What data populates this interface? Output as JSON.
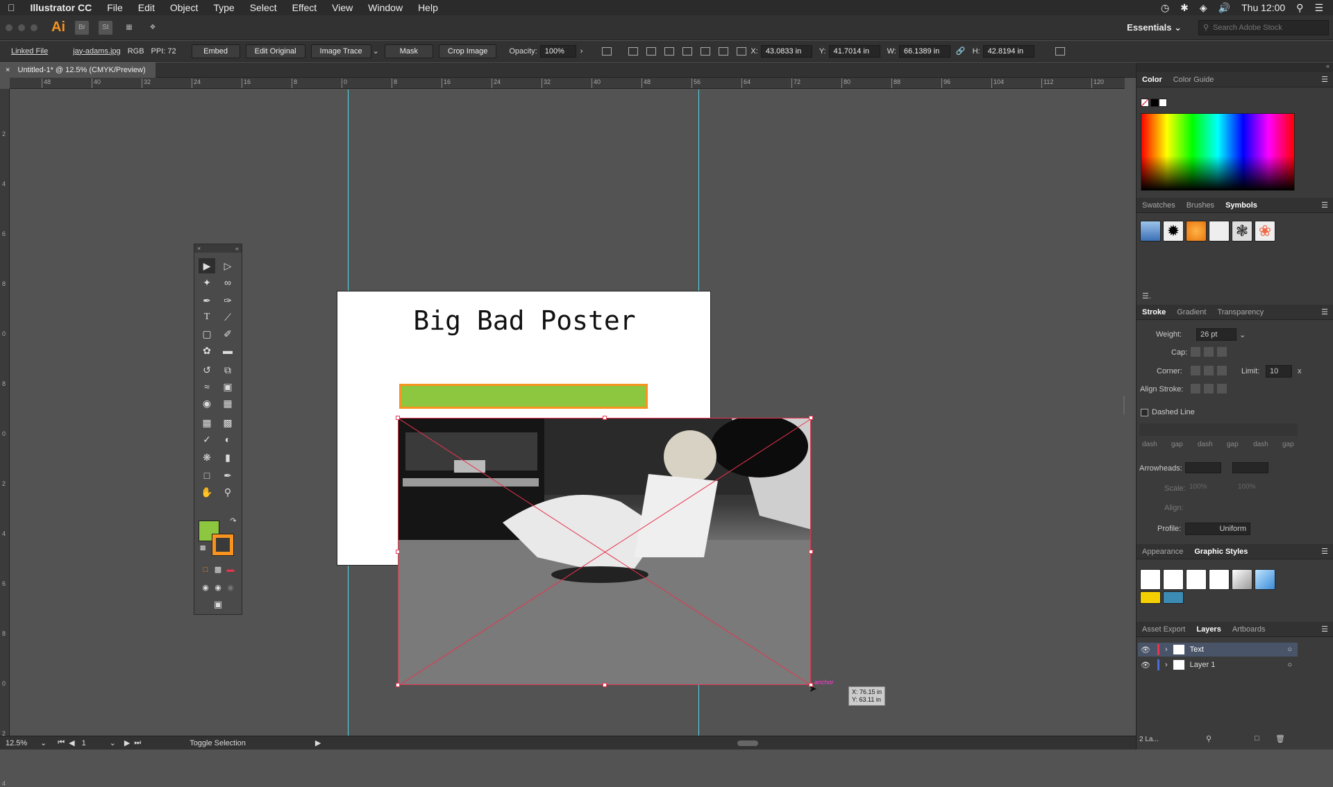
{
  "menubar": {
    "apple_icon": "apple-icon",
    "app_name": "Illustrator CC",
    "items": [
      "File",
      "Edit",
      "Object",
      "Type",
      "Select",
      "Effect",
      "View",
      "Window",
      "Help"
    ],
    "clock": "Thu 12:00"
  },
  "appbar": {
    "logo": "Ai",
    "bridge": "Br",
    "stock": "St",
    "workspace": "Essentials",
    "search_placeholder": "Search Adobe Stock"
  },
  "controlbar": {
    "linked_file": "Linked File",
    "filename": "jay-adams.jpg",
    "color_mode": "RGB",
    "ppi": "PPI: 72",
    "embed": "Embed",
    "edit_original": "Edit Original",
    "image_trace": "Image Trace",
    "mask": "Mask",
    "crop_image": "Crop Image",
    "opacity_label": "Opacity:",
    "opacity_value": "100%",
    "x_label": "X:",
    "x_value": "43.0833 in",
    "y_label": "Y:",
    "y_value": "41.7014 in",
    "w_label": "W:",
    "w_value": "66.1389 in",
    "h_label": "H:",
    "h_value": "42.8194 in"
  },
  "document": {
    "tab_title": "Untitled-1* @ 12.5% (CMYK/Preview)",
    "poster_title": "Big Bad Poster",
    "hruler_ticks": [
      "48",
      "40",
      "32",
      "24",
      "16",
      "8",
      "0",
      "8",
      "16",
      "24",
      "32",
      "40",
      "48",
      "56",
      "64",
      "72",
      "80",
      "88",
      "96",
      "104",
      "112",
      "120"
    ],
    "vruler_ticks": [
      "2",
      "4",
      "6",
      "8",
      "0",
      "8",
      "0",
      "2",
      "4",
      "6",
      "8",
      "0",
      "2",
      "4"
    ],
    "tooltip_label": "anchor",
    "tooltip_x": "X: 76.15 in",
    "tooltip_y": "Y: 63.11 in"
  },
  "statusbar": {
    "zoom": "12.5%",
    "artboard_num": "1",
    "status_text": "Toggle Selection"
  },
  "panels": {
    "color": {
      "tabs": [
        "Color",
        "Color Guide"
      ]
    },
    "swatches": {
      "tabs": [
        "Swatches",
        "Brushes",
        "Symbols"
      ]
    },
    "stroke": {
      "tabs": [
        "Stroke",
        "Gradient",
        "Transparency"
      ],
      "weight_label": "Weight:",
      "weight_value": "26 pt",
      "cap_label": "Cap:",
      "corner_label": "Corner:",
      "limit_label": "Limit:",
      "limit_value": "10",
      "align_label": "Align Stroke:",
      "dashed_label": "Dashed Line",
      "dash_labels": [
        "dash",
        "gap",
        "dash",
        "gap",
        "dash",
        "gap"
      ],
      "arrowheads_label": "Arrowheads:",
      "scale_label": "Scale:",
      "scale_a": "100%",
      "scale_b": "100%",
      "align2_label": "Align:",
      "profile_label": "Profile:",
      "profile_value": "Uniform"
    },
    "appearance": {
      "tabs": [
        "Appearance",
        "Graphic Styles"
      ]
    },
    "layers": {
      "tabs": [
        "Asset Export",
        "Layers",
        "Artboards"
      ],
      "rows": [
        "Text",
        "Layer 1"
      ],
      "footer": "2 La..."
    }
  },
  "colors": {
    "fill": "#8dc63f",
    "stroke": "#f7931e",
    "selection": "#e8344e",
    "guide": "#53d6e6"
  }
}
